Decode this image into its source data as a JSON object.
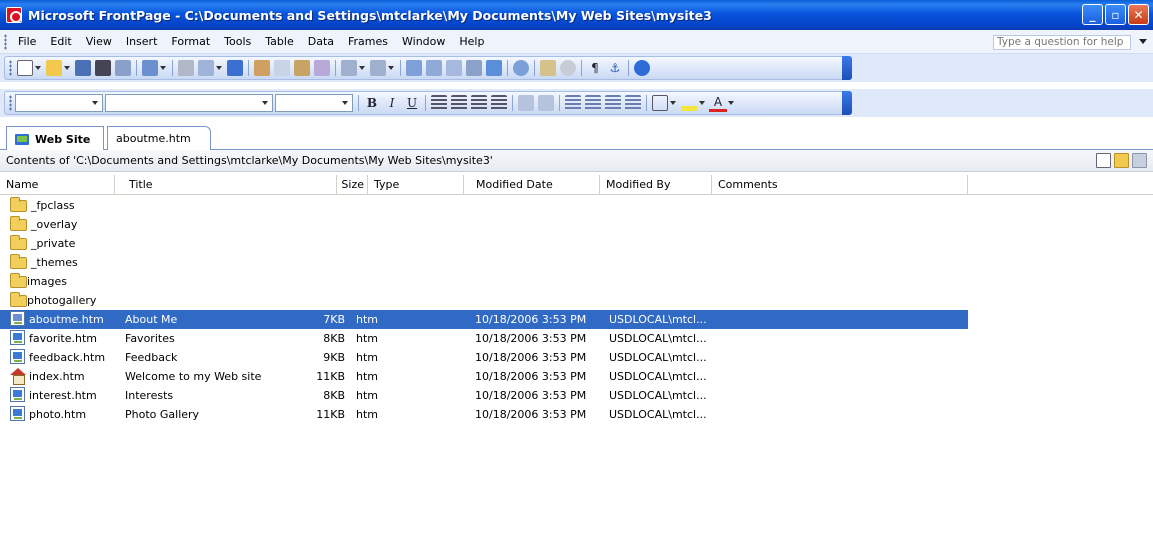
{
  "window": {
    "title": "Microsoft FrontPage - C:\\Documents and Settings\\mtclarke\\My Documents\\My Web Sites\\mysite3",
    "minimize": "_",
    "maximize": "▫",
    "close": "✕"
  },
  "menu": {
    "items": [
      "File",
      "Edit",
      "View",
      "Insert",
      "Format",
      "Tools",
      "Table",
      "Data",
      "Frames",
      "Window",
      "Help"
    ],
    "help_placeholder": "Type a question for help"
  },
  "formatting": {
    "bold": "B",
    "italic": "I",
    "underline": "U",
    "font_color": "A"
  },
  "tabs": [
    {
      "label": "Web Site",
      "active": true
    },
    {
      "label": "aboutme.htm",
      "active": false
    }
  ],
  "path_bar": "Contents of 'C:\\Documents and Settings\\mtclarke\\My Documents\\My Web Sites\\mysite3'",
  "columns": [
    "Name",
    "Title",
    "Size",
    "Type",
    "Modified Date",
    "Modified By",
    "Comments"
  ],
  "rows": [
    {
      "icon": "folder-icon",
      "name": "_fpclass",
      "title": "",
      "size": "",
      "type": "",
      "modified": "",
      "by": ""
    },
    {
      "icon": "folder-icon",
      "name": "_overlay",
      "title": "",
      "size": "",
      "type": "",
      "modified": "",
      "by": ""
    },
    {
      "icon": "folder-icon",
      "name": "_private",
      "title": "",
      "size": "",
      "type": "",
      "modified": "",
      "by": ""
    },
    {
      "icon": "folder-icon",
      "name": "_themes",
      "title": "",
      "size": "",
      "type": "",
      "modified": "",
      "by": ""
    },
    {
      "icon": "folder-icon",
      "name": "images",
      "title": "",
      "size": "",
      "type": "",
      "modified": "",
      "by": ""
    },
    {
      "icon": "folder-icon",
      "name": "photogallery",
      "title": "",
      "size": "",
      "type": "",
      "modified": "",
      "by": ""
    },
    {
      "icon": "page-edit-icon",
      "name": "aboutme.htm",
      "title": "About Me",
      "size": "7KB",
      "type": "htm",
      "modified": "10/18/2006 3:53 PM",
      "by": "USDLOCAL\\mtcl...",
      "selected": true
    },
    {
      "icon": "page-icon",
      "name": "favorite.htm",
      "title": "Favorites",
      "size": "8KB",
      "type": "htm",
      "modified": "10/18/2006 3:53 PM",
      "by": "USDLOCAL\\mtcl..."
    },
    {
      "icon": "page-icon",
      "name": "feedback.htm",
      "title": "Feedback",
      "size": "9KB",
      "type": "htm",
      "modified": "10/18/2006 3:53 PM",
      "by": "USDLOCAL\\mtcl..."
    },
    {
      "icon": "home-icon",
      "name": "index.htm",
      "title": "Welcome to my Web site",
      "size": "11KB",
      "type": "htm",
      "modified": "10/18/2006 3:53 PM",
      "by": "USDLOCAL\\mtcl..."
    },
    {
      "icon": "page-icon",
      "name": "interest.htm",
      "title": "Interests",
      "size": "8KB",
      "type": "htm",
      "modified": "10/18/2006 3:53 PM",
      "by": "USDLOCAL\\mtcl..."
    },
    {
      "icon": "page-icon",
      "name": "photo.htm",
      "title": "Photo Gallery",
      "size": "11KB",
      "type": "htm",
      "modified": "10/18/2006 3:53 PM",
      "by": "USDLOCAL\\mtcl..."
    }
  ],
  "colors": {
    "title_bar": "#0855dd",
    "selection": "#316ac5",
    "toolbar_bg": "#dfe9fa"
  }
}
